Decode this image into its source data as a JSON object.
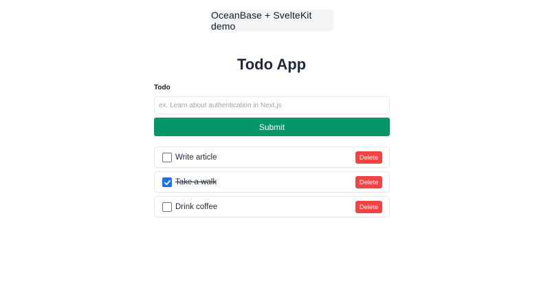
{
  "header": {
    "demo_badge": "OceanBase + SvelteKit demo"
  },
  "main": {
    "title": "Todo App"
  },
  "form": {
    "label": "Todo",
    "input_value": "",
    "input_placeholder": "ex. Learn about authentication in Next.js",
    "submit_label": "Submit"
  },
  "todos": [
    {
      "text": "Write article",
      "completed": false,
      "delete_label": "Delete"
    },
    {
      "text": "Take a walk",
      "completed": true,
      "delete_label": "Delete"
    },
    {
      "text": "Drink coffee",
      "completed": false,
      "delete_label": "Delete"
    }
  ],
  "colors": {
    "submit": "#059669",
    "delete": "#ef4444",
    "checkbox_checked": "#1a73e8",
    "badge_bg": "#f3f4f6"
  },
  "icons": {
    "checkbox_checked": "checkmark-icon"
  }
}
